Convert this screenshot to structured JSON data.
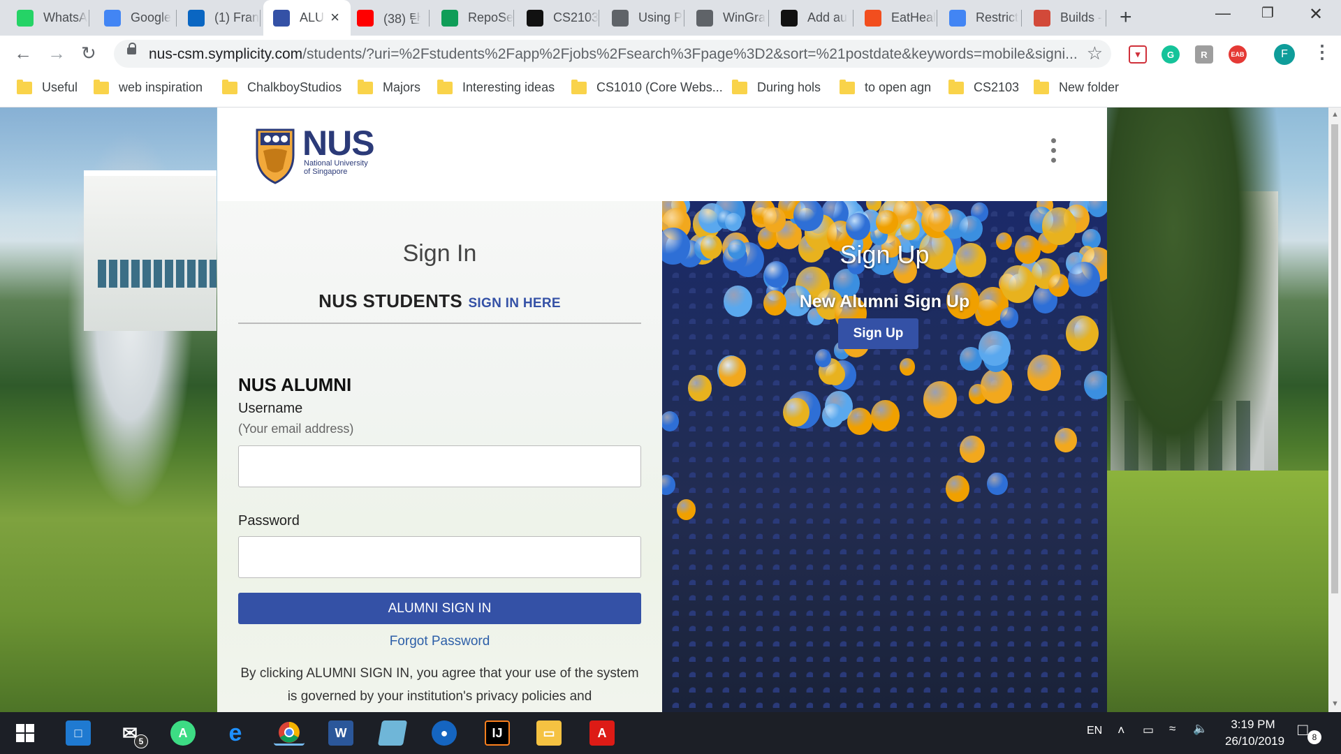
{
  "browser": {
    "tabs": [
      {
        "label": "WhatsA",
        "icon": "whatsapp-icon",
        "color": "#25d366"
      },
      {
        "label": "Google",
        "icon": "google-icon",
        "color": "#4285f4"
      },
      {
        "label": "(1) Fran",
        "icon": "linkedin-icon",
        "color": "#0a66c2"
      },
      {
        "label": "ALU",
        "icon": "page-icon",
        "color": "#3451a6",
        "active": true
      },
      {
        "label": "(38) 탄",
        "icon": "youtube-icon",
        "color": "#ff0000"
      },
      {
        "label": "RepoSe",
        "icon": "repo-icon",
        "color": "#0f9d58"
      },
      {
        "label": "CS2103",
        "icon": "graduation-cap-icon",
        "color": "#111111"
      },
      {
        "label": "Using P",
        "icon": "globe-icon",
        "color": "#5f6368"
      },
      {
        "label": "WinGra",
        "icon": "globe-icon",
        "color": "#5f6368"
      },
      {
        "label": "Add au",
        "icon": "github-icon",
        "color": "#111111"
      },
      {
        "label": "EatHeal",
        "icon": "figma-icon",
        "color": "#f24e1e"
      },
      {
        "label": "Restrict",
        "icon": "google-icon",
        "color": "#4285f4"
      },
      {
        "label": "Builds -",
        "icon": "jenkins-icon",
        "color": "#d24939"
      }
    ],
    "url_host": "nus-csm.symplicity.com",
    "url_path": "/students/?uri=%2Fstudents%2Fapp%2Fjobs%2Fsearch%3Fpage%3D2&sort=%21postdate&keywords=mobile&signi...",
    "bookmarks": [
      "Useful",
      "web inspiration",
      "ChalkboyStudios",
      "Majors",
      "Interesting ideas",
      "CS1010 (Core Webs...",
      "During hols",
      "to open agn",
      "CS2103",
      "New folder"
    ],
    "profile_initial": "F"
  },
  "page": {
    "logo": {
      "title": "NUS",
      "subtitle_line1": "National University",
      "subtitle_line2": "of Singapore"
    },
    "signin": {
      "heading": "Sign In",
      "students_label": "NUS STUDENTS",
      "students_link": "SIGN IN HERE",
      "alumni_title": "NUS ALUMNI",
      "username_label": "Username",
      "username_hint": "(Your email address)",
      "username_value": "",
      "password_label": "Password",
      "password_value": "",
      "signin_button": "ALUMNI SIGN IN",
      "forgot_link": "Forgot Password",
      "terms_text": "By clicking ALUMNI SIGN IN, you agree that your use of the system is governed by your institution's privacy policies and"
    },
    "signup": {
      "heading": "Sign Up",
      "subheading": "New Alumni Sign Up",
      "button": "Sign Up"
    },
    "colors": {
      "primary": "#3451a6",
      "link": "#2d5fa8"
    }
  },
  "taskbar": {
    "mail_badge": "5",
    "language": "EN",
    "time": "3:19 PM",
    "date": "26/10/2019",
    "notifications": "8"
  }
}
